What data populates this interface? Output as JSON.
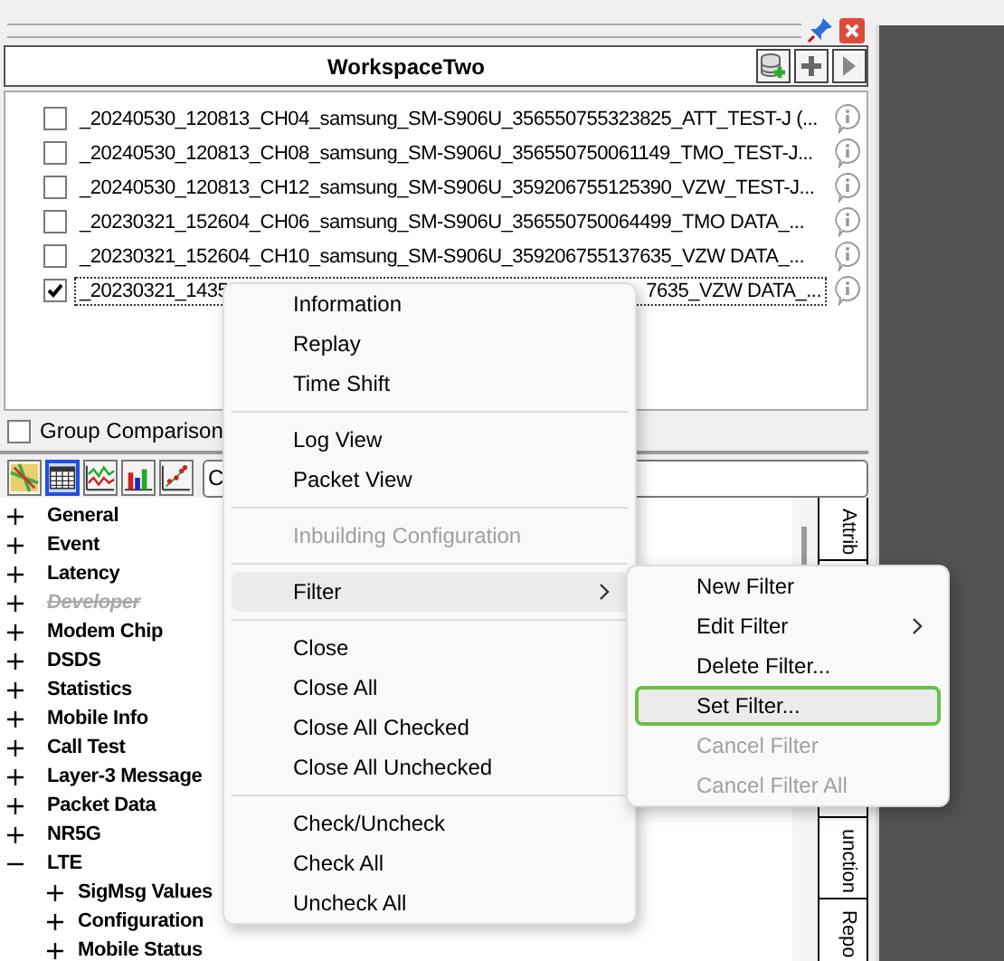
{
  "panel": {
    "title": "WorkspaceTwo"
  },
  "files": [
    {
      "label": "_20240530_120813_CH04_samsung_SM-S906U_356550755323825_ATT_TEST-J (...",
      "checked": false
    },
    {
      "label": "_20240530_120813_CH08_samsung_SM-S906U_356550750061149_TMO_TEST-J...",
      "checked": false
    },
    {
      "label": "_20240530_120813_CH12_samsung_SM-S906U_359206755125390_VZW_TEST-J...",
      "checked": false
    },
    {
      "label": "_20230321_152604_CH06_samsung_SM-S906U_356550750064499_TMO DATA_...",
      "checked": false
    },
    {
      "label": "_20230321_152604_CH10_samsung_SM-S906U_359206755137635_VZW DATA_...",
      "checked": false
    },
    {
      "label": "_20230321_1435",
      "label_tail": "7635_VZW DATA_...",
      "checked": true
    }
  ],
  "group_comparison": {
    "label": "Group Comparison",
    "checked": false
  },
  "view_buttons": [
    {
      "kind": "map",
      "selected": false
    },
    {
      "kind": "table",
      "selected": true
    },
    {
      "kind": "line",
      "selected": false
    },
    {
      "kind": "bar",
      "selected": false
    },
    {
      "kind": "scatter",
      "selected": false
    }
  ],
  "search": {
    "value": "C"
  },
  "tree": [
    {
      "label": "General",
      "expanded": false,
      "disabled": false
    },
    {
      "label": "Event",
      "expanded": false,
      "disabled": false
    },
    {
      "label": "Latency",
      "expanded": false,
      "disabled": false
    },
    {
      "label": "Developer",
      "expanded": false,
      "disabled": true
    },
    {
      "label": "Modem Chip",
      "expanded": false,
      "disabled": false
    },
    {
      "label": "DSDS",
      "expanded": false,
      "disabled": false
    },
    {
      "label": "Statistics",
      "expanded": false,
      "disabled": false
    },
    {
      "label": "Mobile Info",
      "expanded": false,
      "disabled": false
    },
    {
      "label": "Call Test",
      "expanded": false,
      "disabled": false
    },
    {
      "label": "Layer-3 Message",
      "expanded": false,
      "disabled": false
    },
    {
      "label": "Packet Data",
      "expanded": false,
      "disabled": false
    },
    {
      "label": "NR5G",
      "expanded": false,
      "disabled": false
    },
    {
      "label": "LTE",
      "expanded": true,
      "disabled": false,
      "children": [
        {
          "label": "SigMsg Values",
          "expanded": false,
          "disabled": false
        },
        {
          "label": "Configuration",
          "expanded": false,
          "disabled": false
        },
        {
          "label": "Mobile Status",
          "expanded": false,
          "disabled": false
        }
      ]
    }
  ],
  "side_tabs": [
    {
      "label": "Attrib"
    },
    {
      "label": "unction"
    },
    {
      "label": "Repo"
    }
  ],
  "context_menu": {
    "items": [
      {
        "kind": "item",
        "label": "Information",
        "disabled": false,
        "highlighted": false
      },
      {
        "kind": "item",
        "label": "Replay",
        "disabled": false,
        "highlighted": false
      },
      {
        "kind": "item",
        "label": "Time Shift",
        "disabled": false,
        "highlighted": false
      },
      {
        "kind": "separator"
      },
      {
        "kind": "item",
        "label": "Log View",
        "disabled": false,
        "highlighted": false
      },
      {
        "kind": "item",
        "label": "Packet View",
        "disabled": false,
        "highlighted": false
      },
      {
        "kind": "separator"
      },
      {
        "kind": "item",
        "label": "Inbuilding Configuration",
        "disabled": true,
        "highlighted": false
      },
      {
        "kind": "separator"
      },
      {
        "kind": "submenu",
        "label": "Filter",
        "disabled": false,
        "highlighted": true
      },
      {
        "kind": "separator"
      },
      {
        "kind": "item",
        "label": "Close",
        "disabled": false,
        "highlighted": false
      },
      {
        "kind": "item",
        "label": "Close All",
        "disabled": false,
        "highlighted": false
      },
      {
        "kind": "item",
        "label": "Close All Checked",
        "disabled": false,
        "highlighted": false
      },
      {
        "kind": "item",
        "label": "Close All Unchecked",
        "disabled": false,
        "highlighted": false
      },
      {
        "kind": "separator"
      },
      {
        "kind": "item",
        "label": "Check/Uncheck",
        "disabled": false,
        "highlighted": false
      },
      {
        "kind": "item",
        "label": "Check All",
        "disabled": false,
        "highlighted": false
      },
      {
        "kind": "item",
        "label": "Uncheck All",
        "disabled": false,
        "highlighted": false
      }
    ]
  },
  "submenu": {
    "items": [
      {
        "kind": "item",
        "label": "New Filter",
        "disabled": false,
        "highlighted": false
      },
      {
        "kind": "submenu",
        "label": "Edit Filter",
        "disabled": false,
        "highlighted": false
      },
      {
        "kind": "item",
        "label": "Delete Filter...",
        "disabled": false,
        "highlighted": false
      },
      {
        "kind": "item",
        "label": "Set Filter...",
        "disabled": false,
        "highlighted": true
      },
      {
        "kind": "item",
        "label": "Cancel Filter",
        "disabled": true,
        "highlighted": false
      },
      {
        "kind": "item",
        "label": "Cancel Filter All",
        "disabled": true,
        "highlighted": false
      }
    ]
  }
}
